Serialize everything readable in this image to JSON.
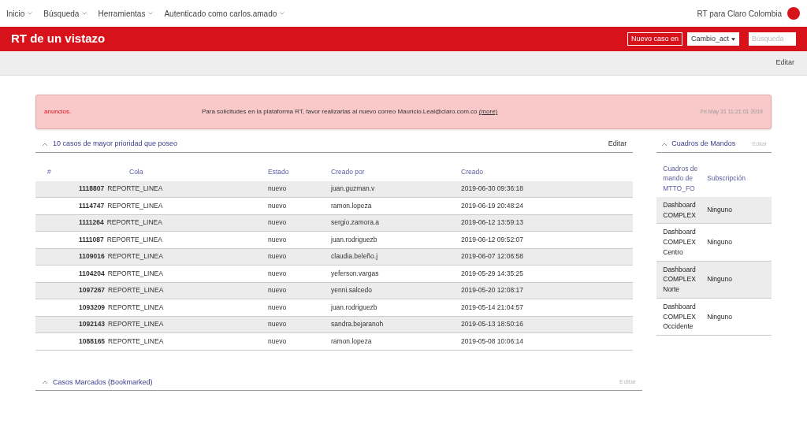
{
  "topnav": {
    "items": [
      "Inicio",
      "Búsqueda",
      "Herramientas",
      "Autenticado como carlos.amado"
    ],
    "brand": "RT para Claro Colombia"
  },
  "header": {
    "title": "RT de un vistazo",
    "new_ticket_button": "Nuevo caso en",
    "queue_select": "Cambio_act",
    "search": {
      "placeholder": "Búsqueda"
    }
  },
  "toolbar": {
    "edit": "Editar"
  },
  "announcement": {
    "label": "anuncios.",
    "message": "Para solicitudes en la plataforma RT, favor realizarlas al nuevo correo Mauricio.Leal@claro.com.co",
    "more": "(more)",
    "date": "Fri May 31 11:21:01 2019"
  },
  "tickets": {
    "title": "10 casos de mayor prioridad que poseo",
    "edit": "Editar",
    "columns": [
      "#",
      "Cola",
      "Estado",
      "Creado por",
      "Creado"
    ],
    "rows": [
      {
        "id": "1118807",
        "queue": "REPORTE_LINEA",
        "status": "nuevo",
        "creator": "juan.guzman.v",
        "created": "2019-06-30 09:36:18"
      },
      {
        "id": "1114747",
        "queue": "REPORTE_LINEA",
        "status": "nuevo",
        "creator": "ramon.lopeza",
        "created": "2019-06-19 20:48:24"
      },
      {
        "id": "1111264",
        "queue": "REPORTE_LINEA",
        "status": "nuevo",
        "creator": "sergio.zamora.a",
        "created": "2019-06-12 13:59:13"
      },
      {
        "id": "1111087",
        "queue": "REPORTE_LINEA",
        "status": "nuevo",
        "creator": "juan.rodriguezb",
        "created": "2019-06-12 09:52:07"
      },
      {
        "id": "1109016",
        "queue": "REPORTE_LINEA",
        "status": "nuevo",
        "creator": "claudia.beleño.j",
        "created": "2019-06-07 12:06:58"
      },
      {
        "id": "1104204",
        "queue": "REPORTE_LINEA",
        "status": "nuevo",
        "creator": "yeferson.vargas",
        "created": "2019-05-29 14:35:25"
      },
      {
        "id": "1097267",
        "queue": "REPORTE_LINEA",
        "status": "nuevo",
        "creator": "yenni.salcedo",
        "created": "2019-05-20 12:08:17"
      },
      {
        "id": "1093209",
        "queue": "REPORTE_LINEA",
        "status": "nuevo",
        "creator": "juan.rodriguezb",
        "created": "2019-05-14 21:04:57"
      },
      {
        "id": "1092143",
        "queue": "REPORTE_LINEA",
        "status": "nuevo",
        "creator": "sandra.bejaranoh",
        "created": "2019-05-13 18:50:16"
      },
      {
        "id": "1088165",
        "queue": "REPORTE_LINEA",
        "status": "nuevo",
        "creator": "ramon.lopeza",
        "created": "2019-05-08 10:06:14"
      }
    ]
  },
  "dashboards": {
    "title": "Cuadros de Mandos",
    "edit": "Editar",
    "columns": [
      "Cuadros de mando de MTTO_FO",
      "Subscripción"
    ],
    "rows": [
      {
        "name": "Dashboard COMPLEX",
        "subscription": "Ninguno"
      },
      {
        "name": "Dashboard COMPLEX Centro",
        "subscription": "Ninguno"
      },
      {
        "name": "Dashboard COMPLEX Norte",
        "subscription": "Ninguno"
      },
      {
        "name": "Dashboard COMPLEX Occidente",
        "subscription": "Ninguno"
      }
    ]
  },
  "bookmarked": {
    "title": "Casos Marcados (Bookmarked)",
    "edit": "Editar"
  }
}
